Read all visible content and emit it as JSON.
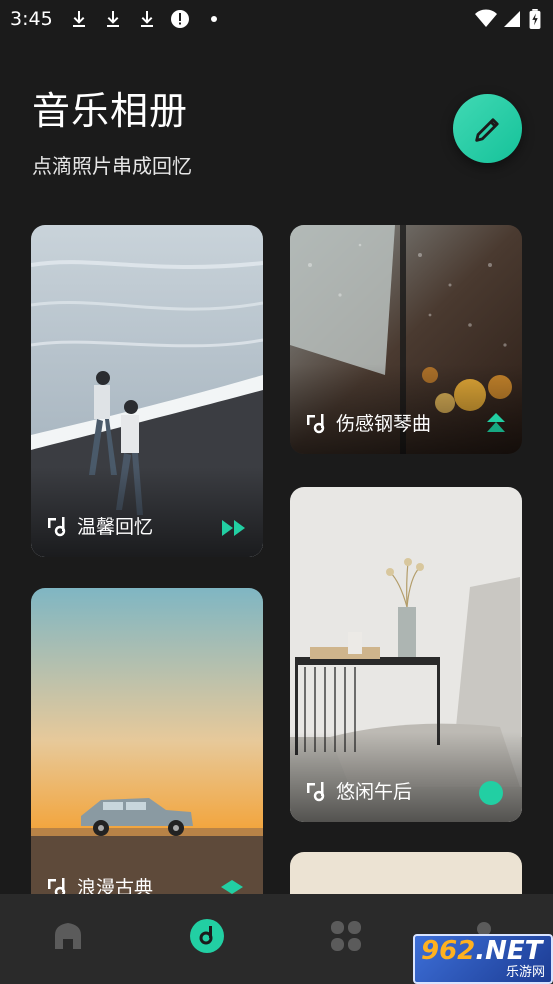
{
  "status_bar": {
    "time": "3:45"
  },
  "header": {
    "title": "音乐相册",
    "subtitle": "点滴照片串成回忆",
    "edit_icon": "pencil-icon"
  },
  "cards": [
    {
      "label": "温馨回忆",
      "icon": "music-note-icon",
      "tag_icon": "fast-forward-icon"
    },
    {
      "label": "伤感钢琴曲",
      "icon": "music-note-icon",
      "tag_icon": "stack-arrow-icon"
    },
    {
      "label": "悠闲午后",
      "icon": "music-note-icon",
      "tag_icon": "circle-icon"
    },
    {
      "label": "浪漫古典",
      "icon": "music-note-icon",
      "tag_icon": "diamond-icon"
    }
  ],
  "bottom_nav": {
    "items": [
      {
        "name": "home",
        "icon": "home-icon"
      },
      {
        "name": "music",
        "icon": "music-disc-icon",
        "active": true
      },
      {
        "name": "apps",
        "icon": "grid-icon"
      },
      {
        "name": "profile",
        "icon": "person-icon"
      }
    ]
  },
  "watermark": {
    "logo": "962",
    "suffix": ".NET",
    "text": "乐游网"
  },
  "colors": {
    "accent": "#22cfa3",
    "background": "#1b1b1b",
    "nav": "#2a2a2a"
  }
}
